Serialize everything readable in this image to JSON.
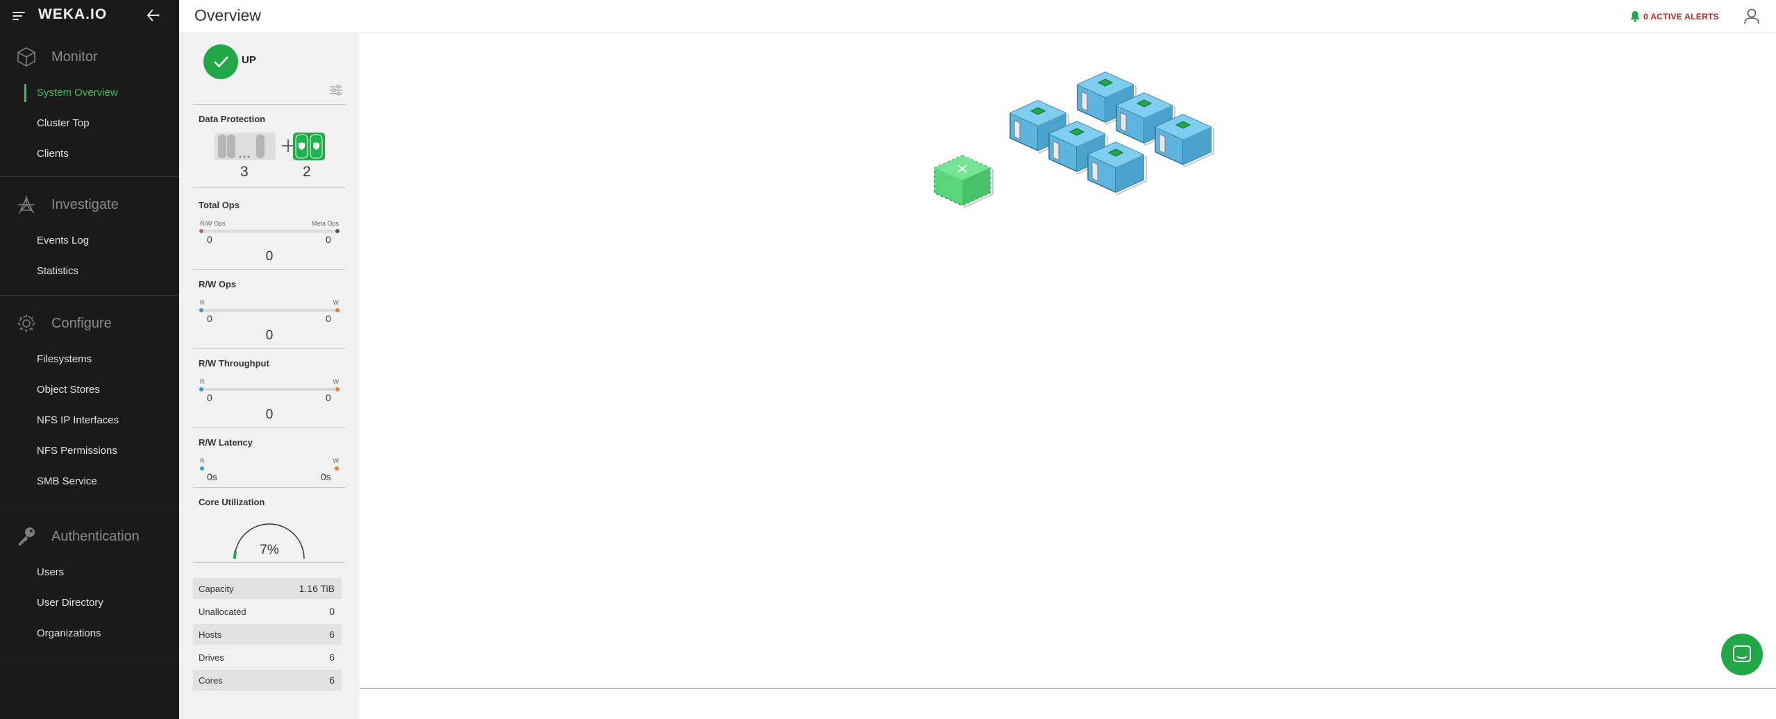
{
  "app": {
    "logo": "WEKA.IO",
    "page_title": "Overview"
  },
  "header": {
    "alerts_label": "0 ACTIVE ALERTS"
  },
  "sidebar": {
    "sections": [
      {
        "title": "Monitor",
        "icon": "cube-icon",
        "items": [
          "System Overview",
          "Cluster Top",
          "Clients"
        ],
        "active": "System Overview"
      },
      {
        "title": "Investigate",
        "icon": "investigate-icon",
        "items": [
          "Events Log",
          "Statistics"
        ]
      },
      {
        "title": "Configure",
        "icon": "gear-icon",
        "items": [
          "Filesystems",
          "Object Stores",
          "NFS IP Interfaces",
          "NFS Permissions",
          "SMB Service"
        ]
      },
      {
        "title": "Authentication",
        "icon": "key-icon",
        "items": [
          "Users",
          "User Directory",
          "Organizations"
        ]
      }
    ]
  },
  "status": {
    "label": "UP",
    "color": "#1fa845"
  },
  "data_protection": {
    "title": "Data Protection",
    "data_drives": "3",
    "parity_drives": "2"
  },
  "total_ops": {
    "title": "Total Ops",
    "left_label": "R/W Ops",
    "right_label": "Meta Ops",
    "left_value": "0",
    "right_value": "0",
    "total": "0"
  },
  "rw_ops": {
    "title": "R/W Ops",
    "left_label": "R",
    "right_label": "W",
    "left_value": "0",
    "right_value": "0",
    "total": "0"
  },
  "rw_throughput": {
    "title": "R/W Throughput",
    "left_label": "R",
    "right_label": "W",
    "left_value": "0",
    "right_value": "0",
    "total": "0"
  },
  "rw_latency": {
    "title": "R/W Latency",
    "left_label": "R",
    "right_label": "W",
    "left_value": "0s",
    "right_value": "0s"
  },
  "core_utilization": {
    "title": "Core Utilization",
    "value": "7%",
    "fraction": 0.07
  },
  "capacity_table": [
    {
      "label": "Capacity",
      "value": "1.16 TiB"
    },
    {
      "label": "Unallocated",
      "value": "0"
    },
    {
      "label": "Hosts",
      "value": "6"
    },
    {
      "label": "Drives",
      "value": "6"
    },
    {
      "label": "Cores",
      "value": "6"
    }
  ],
  "colors": {
    "accent": "#3fbf5a",
    "read": "#2e9bd6",
    "write": "#f07a2a",
    "alert": "#b32828",
    "host": "#6cc5ea",
    "backend": "#5cd67e"
  }
}
